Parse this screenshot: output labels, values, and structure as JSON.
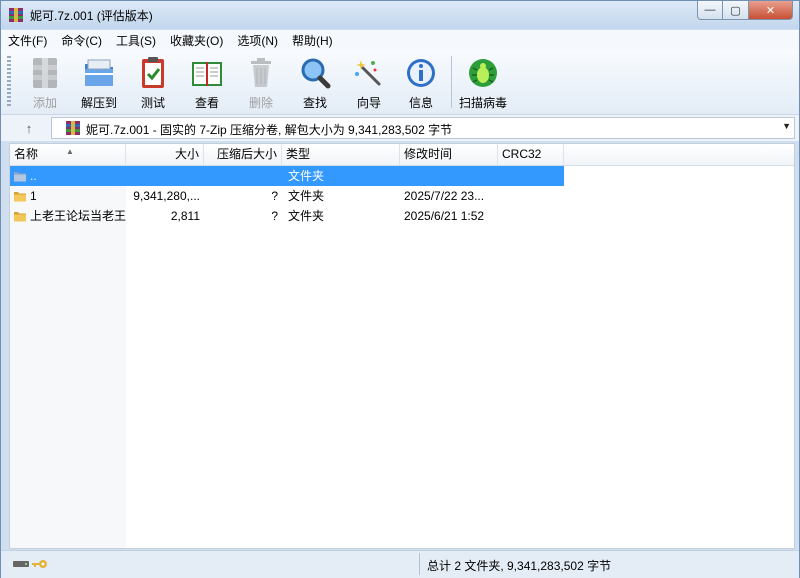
{
  "window": {
    "title": "妮可.7z.001 (评估版本)",
    "buttons": {
      "minimize": "—",
      "maximize": "▢",
      "close": "✕"
    }
  },
  "menu": [
    "文件(F)",
    "命令(C)",
    "工具(S)",
    "收藏夹(O)",
    "选项(N)",
    "帮助(H)"
  ],
  "toolbar": {
    "add": "添加",
    "extract": "解压到",
    "test": "测试",
    "view": "查看",
    "delete": "删除",
    "find": "查找",
    "wizard": "向导",
    "info": "信息",
    "scan": "扫描病毒"
  },
  "address": {
    "up": "↑",
    "text": "妮可.7z.001 - 固实的 7-Zip 压缩分卷, 解包大小为 9,341,283,502 字节"
  },
  "columns": [
    "名称",
    "大小",
    "压缩后大小",
    "类型",
    "修改时间",
    "CRC32"
  ],
  "files": [
    {
      "name": "..",
      "size": "",
      "packed": "",
      "type": "文件夹",
      "modified": "",
      "crc": "",
      "selected": true,
      "icon": "folder-up-icon"
    },
    {
      "name": "1",
      "size": "9,341,280,...",
      "packed": "?",
      "type": "文件夹",
      "modified": "2025/7/22 23...",
      "crc": "",
      "selected": false,
      "icon": "folder-icon"
    },
    {
      "name": "上老王论坛当老王",
      "size": "2,811",
      "packed": "?",
      "type": "文件夹",
      "modified": "2025/6/21 1:52",
      "crc": "",
      "selected": false,
      "icon": "folder-icon"
    }
  ],
  "status": {
    "summary": "总计 2 文件夹, 9,341,283,502 字节"
  },
  "colors": {
    "selection": "#3399ff",
    "title_bg": "#cfdff0",
    "folder": "#e8b84a"
  }
}
